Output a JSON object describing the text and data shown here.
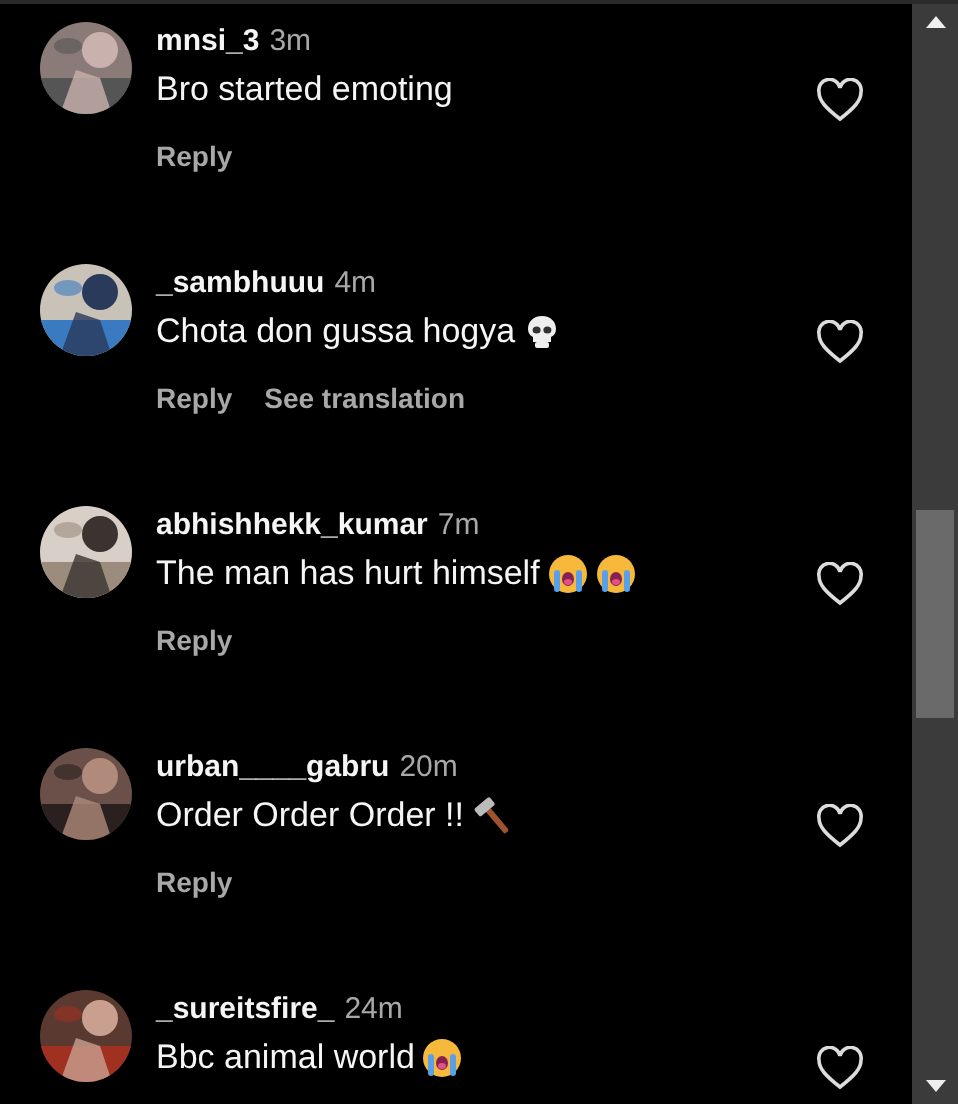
{
  "comments": [
    {
      "username": "mnsi_3",
      "time": "3m",
      "text": "Bro started emoting",
      "actions": [
        "Reply"
      ]
    },
    {
      "username": "_sambhuuu",
      "time": "4m",
      "text": "Chota don gussa hogya",
      "emoji": [
        {
          "kind": "skull"
        }
      ],
      "actions": [
        "Reply",
        "See translation"
      ]
    },
    {
      "username": "abhishhekk_kumar",
      "time": "7m",
      "text": "The man has hurt himself",
      "emoji": [
        {
          "kind": "crying"
        },
        {
          "kind": "crying"
        }
      ],
      "actions": [
        "Reply"
      ]
    },
    {
      "username": "urban____gabru",
      "time": "20m",
      "text": "Order Order Order !!",
      "emoji": [
        {
          "kind": "hammer"
        }
      ],
      "actions": [
        "Reply"
      ]
    },
    {
      "username": "_sureitsfire_",
      "time": "24m",
      "text": "Bbc animal world",
      "emoji": [
        {
          "kind": "crying"
        }
      ]
    }
  ]
}
